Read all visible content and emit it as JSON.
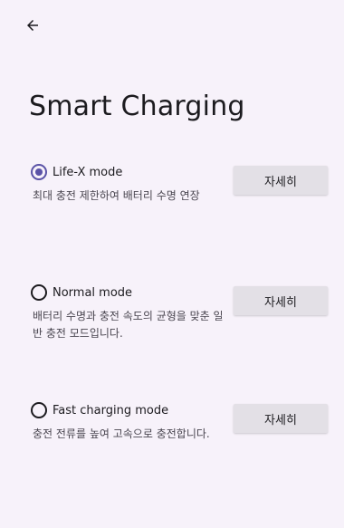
{
  "header": {
    "back_icon": "arrow-left-icon",
    "title": "Smart Charging"
  },
  "options": [
    {
      "label": "Life-X mode",
      "description": "최대 충전 제한하여 배터리 수명 연장",
      "selected": true,
      "button_label": "자세히"
    },
    {
      "label": "Normal mode",
      "description": "배터리 수명과 충전 속도의 균형을 맞춘 일반 충전 모드입니다.",
      "selected": false,
      "button_label": "자세히"
    },
    {
      "label": "Fast charging mode",
      "description": "충전 전류를 높여 고속으로 충전합니다.",
      "selected": false,
      "button_label": "자세히"
    }
  ],
  "colors": {
    "background": "#f7f2fa",
    "accent": "#5b53a7",
    "button_bg": "#e3e0e6"
  }
}
